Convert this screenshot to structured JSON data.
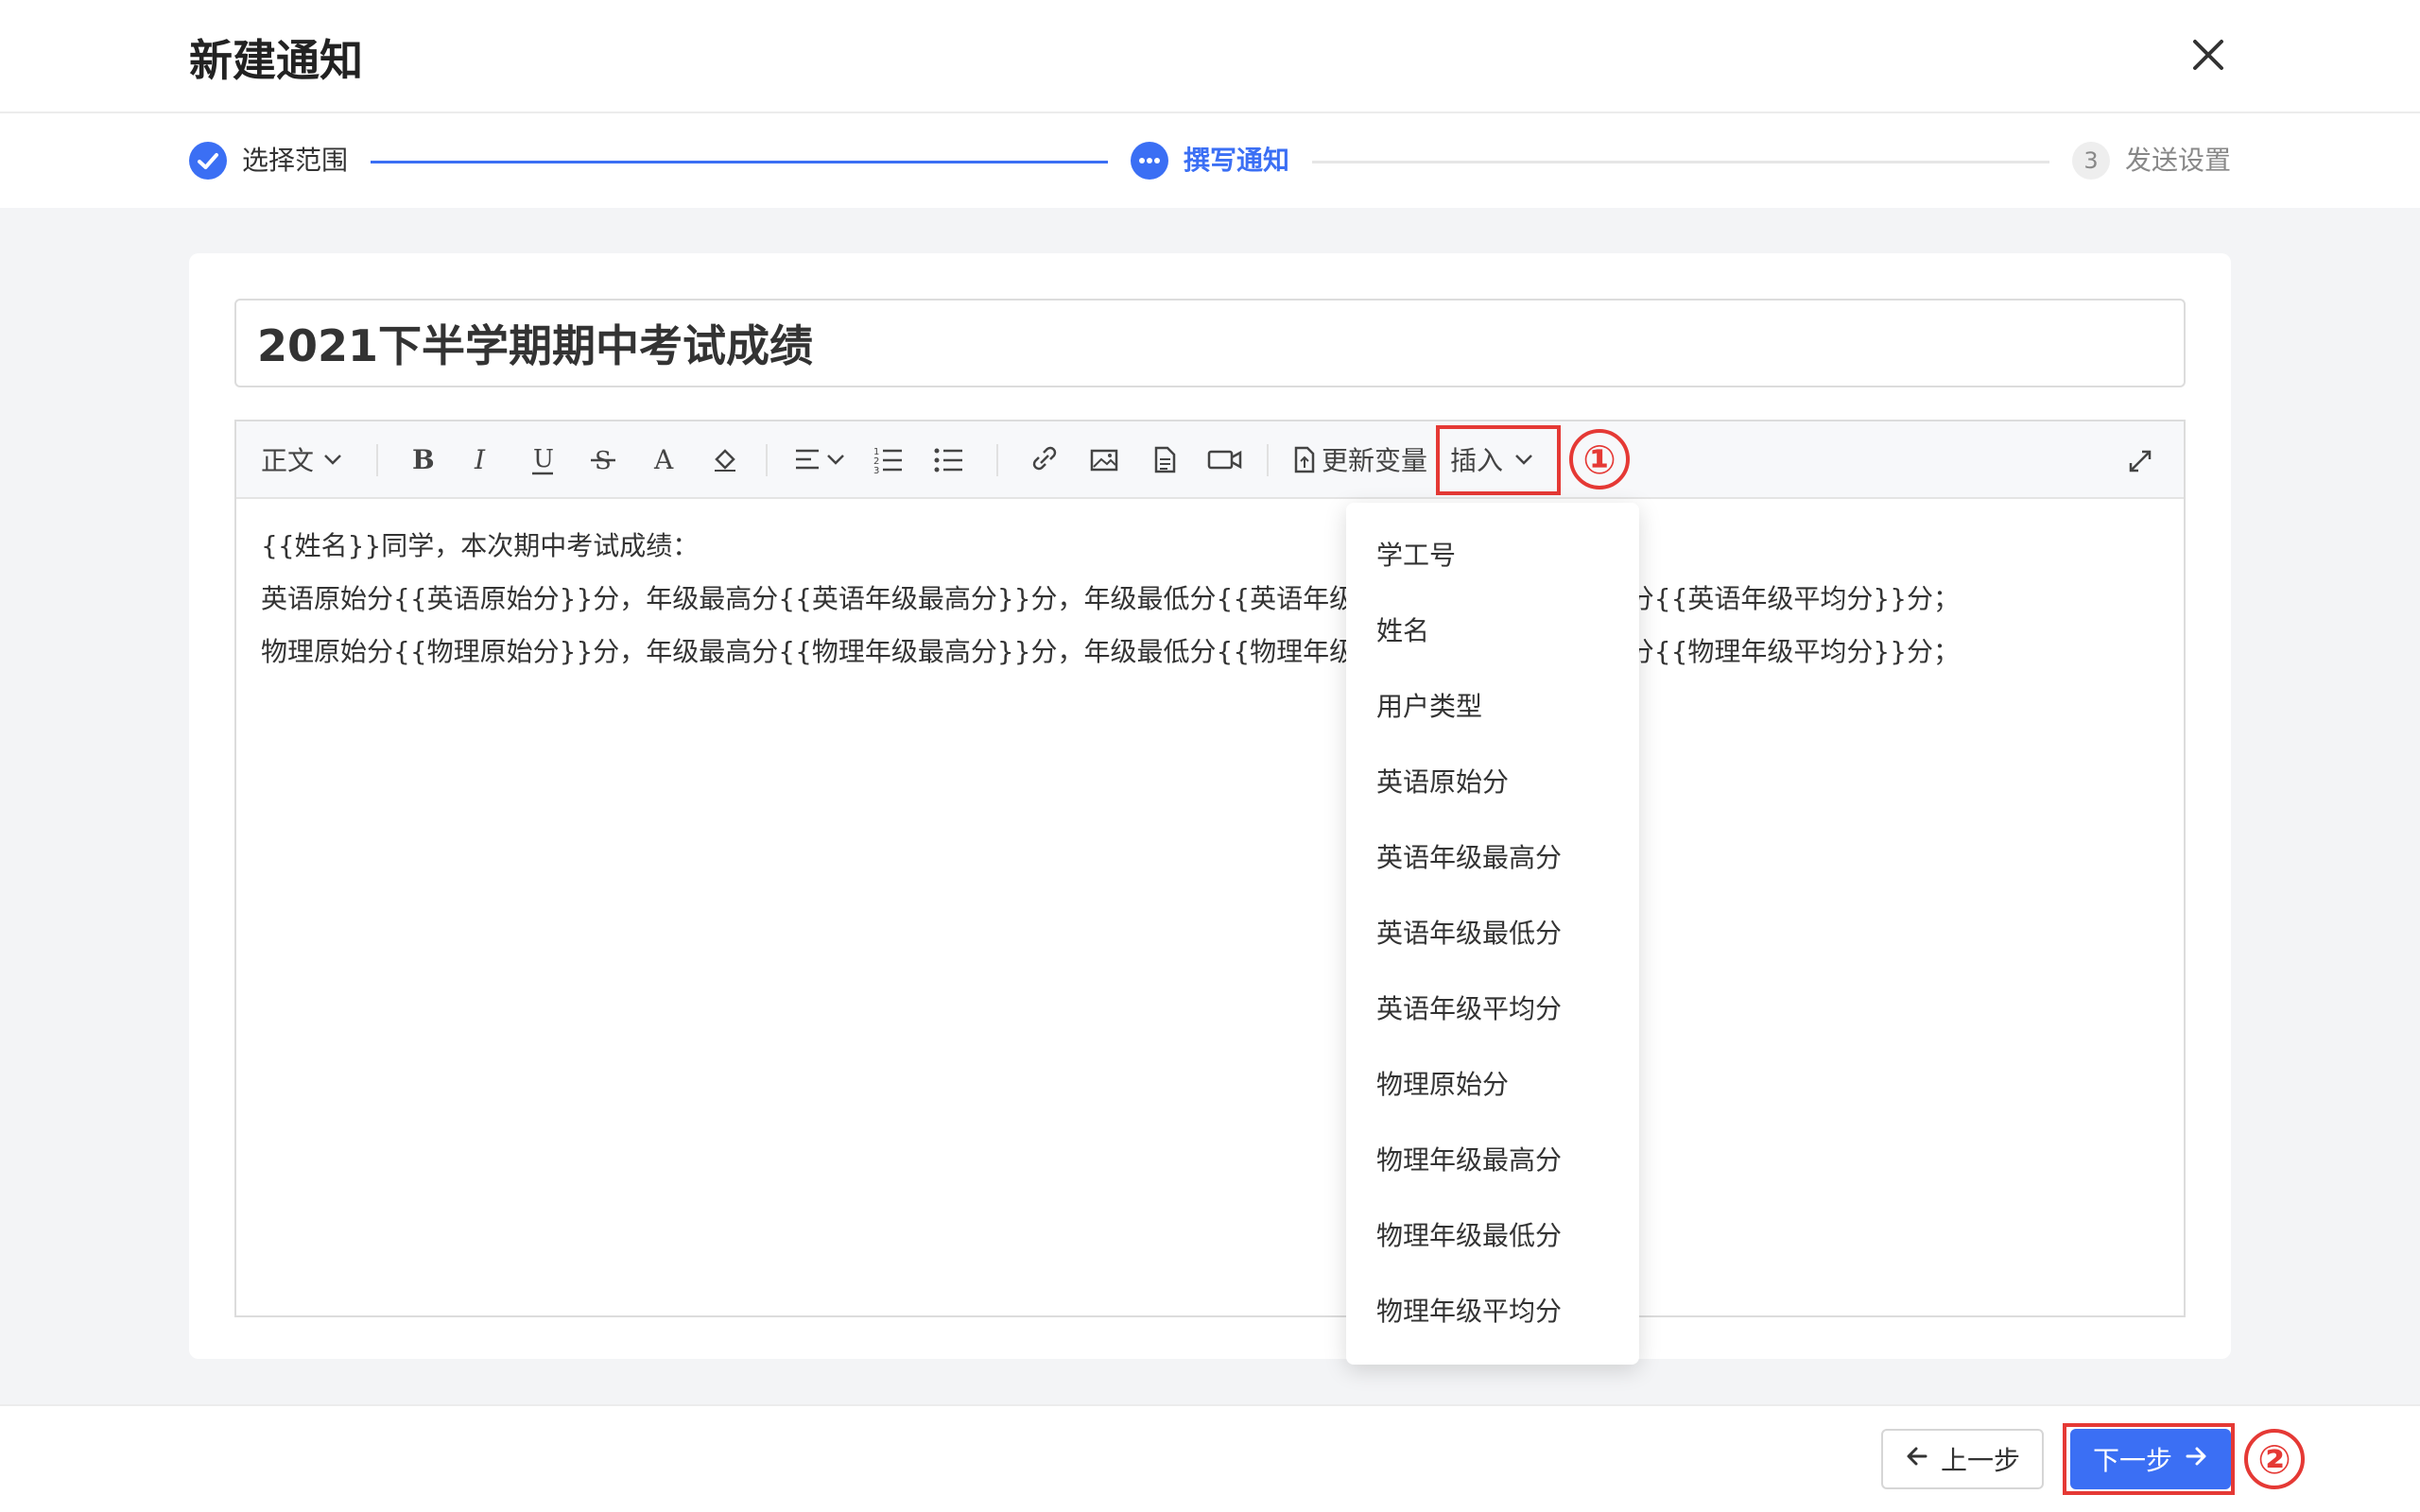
{
  "header": {
    "title": "新建通知"
  },
  "steps": [
    {
      "label": "选择范围",
      "status": "done"
    },
    {
      "label": "撰写通知",
      "status": "active"
    },
    {
      "number": "3",
      "label": "发送设置",
      "status": "pending"
    }
  ],
  "notice": {
    "title": "2021下半学期期中考试成绩"
  },
  "toolbar": {
    "paragraph_style": "正文",
    "update_variable": "更新变量",
    "insert": "插入"
  },
  "editor": {
    "lines": [
      "{{姓名}}同学，本次期中考试成绩：",
      "英语原始分{{英语原始分}}分，年级最高分{{英语年级最高分}}分，年级最低分{{英语年级最低分}}分，年级平均分{{英语年级平均分}}分；",
      "物理原始分{{物理原始分}}分，年级最高分{{物理年级最高分}}分，年级最低分{{物理年级最低分}}分，年级平均分{{物理年级平均分}}分；"
    ]
  },
  "insert_menu": {
    "items": [
      "学工号",
      "姓名",
      "用户类型",
      "英语原始分",
      "英语年级最高分",
      "英语年级最低分",
      "英语年级平均分",
      "物理原始分",
      "物理年级最高分",
      "物理年级最低分",
      "物理年级平均分"
    ]
  },
  "annotations": {
    "one": "①",
    "two": "②"
  },
  "footer": {
    "prev": "上一步",
    "next": "下一步"
  },
  "colors": {
    "accent": "#3b6ff4",
    "annotation": "#e53935"
  }
}
